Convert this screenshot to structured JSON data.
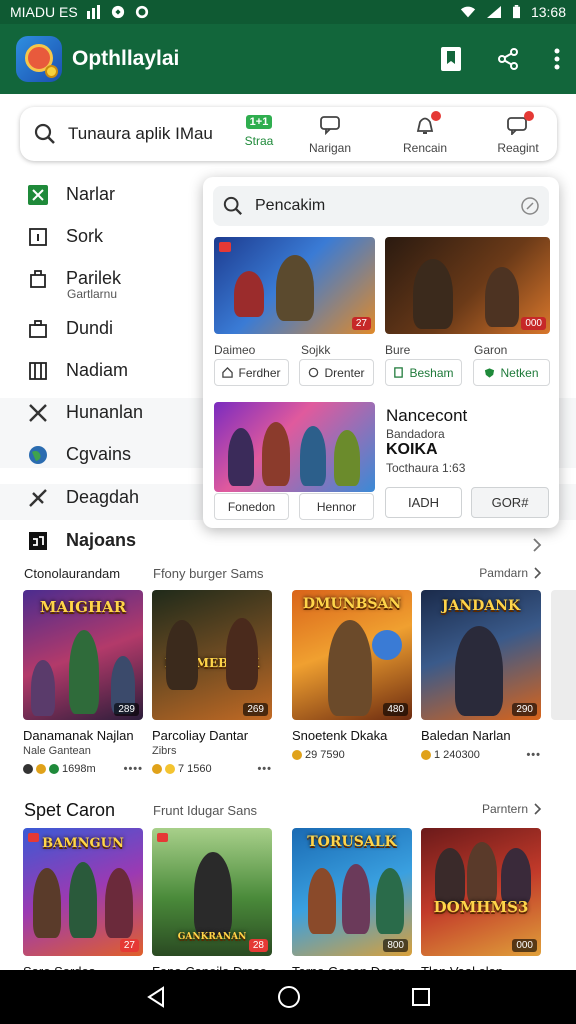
{
  "status_bar": {
    "carrier": "MIADU ES",
    "time": "13:68"
  },
  "app_bar": {
    "title": "Opthllaylai",
    "icons": [
      "bookmark-icon",
      "share-icon",
      "more-vert-icon"
    ]
  },
  "search": {
    "query": "Tunaura aplik IMau",
    "smart_badge": "1+1",
    "smart_label": "Straa",
    "tabs": [
      {
        "label": "Narigan",
        "icon": "chat-icon",
        "badge": false
      },
      {
        "label": "Rencain",
        "icon": "bell-icon",
        "badge": true
      },
      {
        "label": "Reagint",
        "icon": "message-icon",
        "badge": true
      }
    ]
  },
  "sidebar": {
    "items": [
      {
        "label": "Narlar",
        "icon": "grid-icon"
      },
      {
        "label": "Sork",
        "icon": "info-square-icon"
      },
      {
        "label": "Parilek",
        "sub": "Gartlarnu",
        "icon": "store-icon"
      },
      {
        "label": "Dundi",
        "icon": "briefcase-icon"
      },
      {
        "label": "Nadiam",
        "icon": "book-icon"
      },
      {
        "label": "Hunanlan",
        "icon": "swords-icon"
      },
      {
        "label": "Cgvains",
        "icon": "globe-icon"
      },
      {
        "label": "Deagdah",
        "icon": "tools-icon"
      },
      {
        "label": "Najoans",
        "icon": "calendar-icon"
      }
    ]
  },
  "popup": {
    "search_placeholder": "Pencakim",
    "thumbs": [
      {
        "tag": "27"
      },
      {
        "tag": "000"
      },
      {
        "tag": ""
      }
    ],
    "labels": [
      "Daimeo",
      "Sojkk",
      "Bure",
      "Garon"
    ],
    "pills": [
      {
        "label": "Ferdher",
        "icon": "home-icon"
      },
      {
        "label": "Drenter",
        "icon": "refresh-icon"
      },
      {
        "label": "Besham",
        "icon": "doc-icon"
      },
      {
        "label": "Netken",
        "icon": "shield-icon"
      }
    ],
    "pill_under_thumb": [
      "Fonedon",
      "Hennor"
    ],
    "featured": {
      "title": "Nancecont",
      "line1": "Bandadora",
      "big": "KOIKA",
      "line2": "Tocthaura 1:63"
    },
    "buttons": [
      "IADH",
      "GOR#"
    ]
  },
  "section1": {
    "header_left": "Ctonolaurandam",
    "header_mid": "Ffony burger Sams",
    "more": "Pamdarn",
    "cards": [
      {
        "name": "Danamanak Najlan",
        "sub": "Nale Gantean",
        "meta": "1698m",
        "tag": "289",
        "art_title": "MAIGHAR"
      },
      {
        "name": "Parcoliay Dantar",
        "sub": "Zibrs",
        "meta": "7 1560",
        "tag": "269",
        "art_title": "DANMEBANK"
      },
      {
        "name": "Snoetenk Dkaka",
        "sub": "",
        "meta": "29 7590",
        "tag": "480",
        "art_title": "DMUNBSAN"
      },
      {
        "name": "Baledan Narlan",
        "sub": "",
        "meta": "1 240300",
        "tag": "290",
        "art_title": "JANDANK"
      }
    ]
  },
  "section2": {
    "header_left": "Spet Caron",
    "header_mid": "Frunt Idugar Sans",
    "more": "Parntern",
    "cards": [
      {
        "name": "Saro Sordes",
        "tag": "27",
        "art_title": "BAMNGUN"
      },
      {
        "name": "Fana Caneila Drsse",
        "tag": "28",
        "art_title": "GANKRANAN"
      },
      {
        "name": "Tarna Gaean Deara",
        "tag": "800",
        "art_title": "TORUSALK"
      },
      {
        "name": "Tlan Vaal alan",
        "tag": "000",
        "art_title": "DOMHMS3"
      }
    ]
  },
  "nav_bar": {
    "buttons": [
      "back-icon",
      "home-circle-icon",
      "recents-square-icon"
    ]
  }
}
